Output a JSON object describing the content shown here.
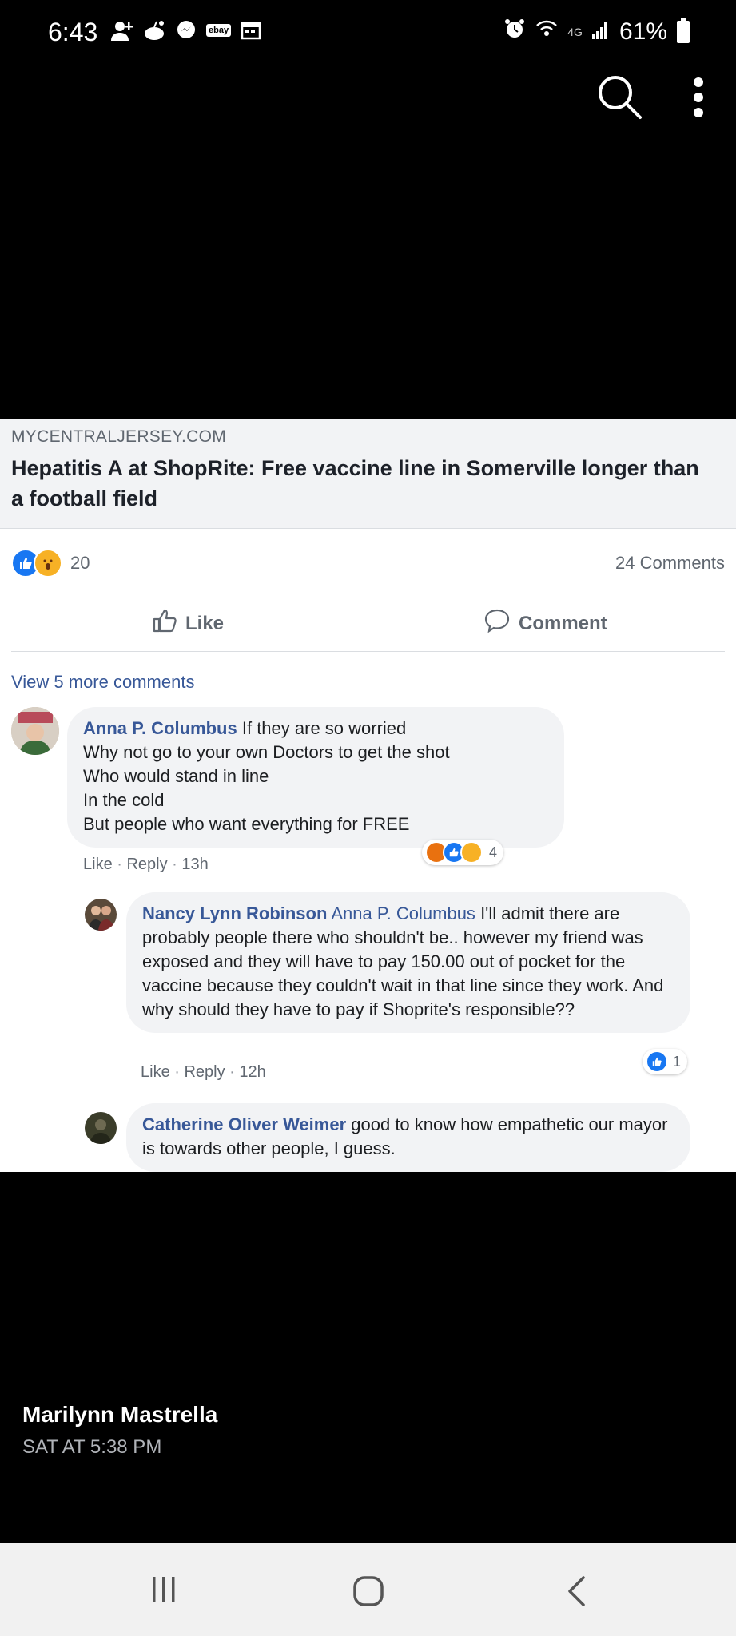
{
  "status_bar": {
    "time": "6:43",
    "network": "4G",
    "battery": "61%",
    "ebay_label": "ebay"
  },
  "post": {
    "source": "MYCENTRALJERSEY.COM",
    "headline": "Hepatitis A at ShopRite: Free vaccine line in Somerville longer than a football field",
    "reaction_count": "20",
    "comment_count": "24 Comments",
    "like_label": "Like",
    "comment_label": "Comment",
    "view_more": "View 5 more comments"
  },
  "comments": [
    {
      "author": "Anna P. Columbus",
      "text": "If they are so worried",
      "lines": [
        "Why not go to your own Doctors to get the shot",
        "Who would stand in line",
        "In the cold",
        "But people who want everything for FREE"
      ],
      "like": "Like",
      "reply": "Reply",
      "time": "13h",
      "reactions": "4"
    },
    {
      "author": "Nancy Lynn Robinson",
      "mention": "Anna P. Columbus",
      "text": "I'll admit there are probably people there who shouldn't be.. however my friend was exposed and they will have to pay 150.00 out of pocket for the vaccine because they couldn't wait in that line since they work. And why should they have to pay if Shoprite's responsible??",
      "like": "Like",
      "reply": "Reply",
      "time": "12h",
      "reactions": "1"
    },
    {
      "author": "Catherine Oliver Weimer",
      "text": "good to know how empathetic our mayor is towards other people, I guess."
    }
  ],
  "poster": {
    "name": "Marilynn Mastrella",
    "time": "SAT AT 5:38 PM"
  },
  "colors": {
    "link_blue": "#385898",
    "like_blue": "#1877f2",
    "wow_yellow": "#f7b125",
    "angry_orange": "#e9710f"
  },
  "icons": [
    "search-icon",
    "more-vert-icon",
    "like-icon",
    "comment-icon",
    "recents-icon",
    "home-icon",
    "back-icon"
  ]
}
